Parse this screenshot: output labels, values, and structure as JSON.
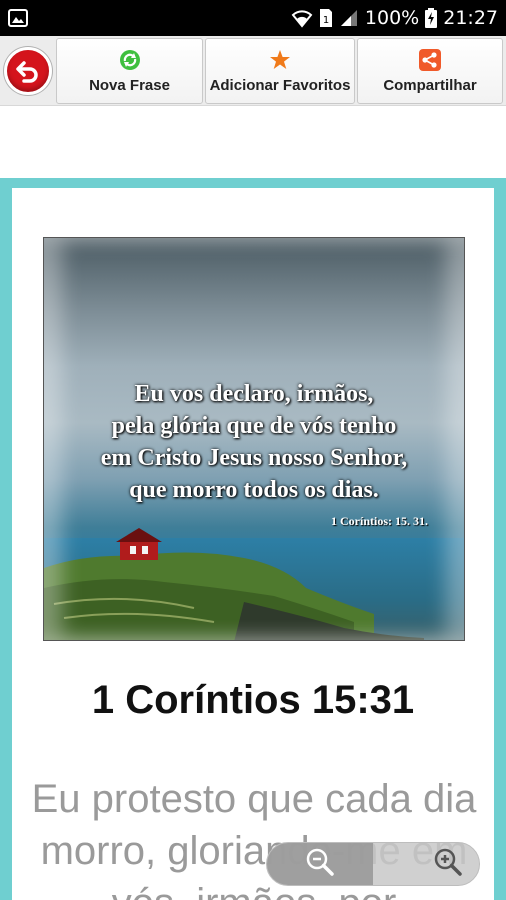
{
  "status_bar": {
    "battery_percent": "100%",
    "time": "21:27",
    "icons": [
      "image-icon",
      "wifi-icon",
      "sim-icon",
      "signal-icon",
      "battery-charging-icon"
    ]
  },
  "toolbar": {
    "back_icon": "back-arrow-icon",
    "buttons": [
      {
        "label": "Nova Frase",
        "icon": "refresh-icon",
        "color": "#3fbf3f"
      },
      {
        "label": "Adicionar Favoritos",
        "icon": "star-icon",
        "color": "#f07a1a"
      },
      {
        "label": "Compartilhar",
        "icon": "share-icon",
        "color": "#f05a2a"
      }
    ]
  },
  "image": {
    "lines": [
      "Eu vos declaro, irmãos,",
      "pela glória que de vós tenho",
      "em Cristo Jesus nosso Senhor,",
      "que morro todos os dias."
    ],
    "reference": "1 Coríntios: 15. 31."
  },
  "verse": {
    "title": "1 Coríntios 15:31",
    "text": "Eu protesto que cada dia morro, gloriando-me em vós, irmãos, por"
  },
  "zoom": {
    "out_icon": "zoom-out-icon",
    "in_icon": "zoom-in-icon"
  },
  "colors": {
    "accent_frame": "#6fcfd0",
    "back_button": "#d4141c"
  }
}
